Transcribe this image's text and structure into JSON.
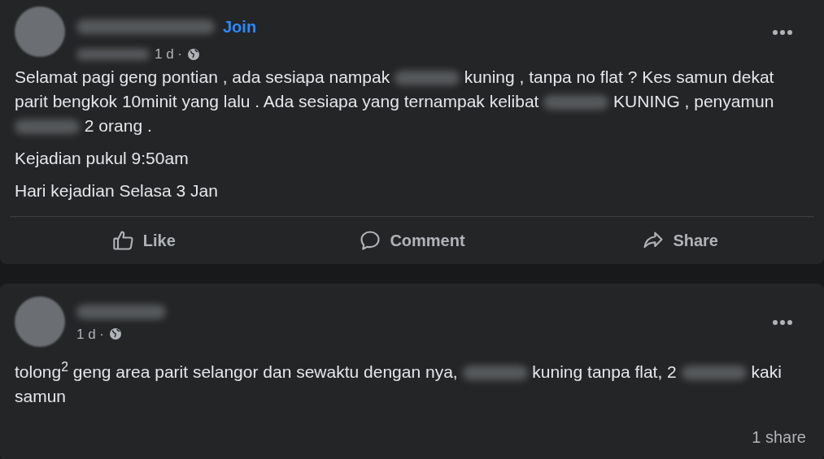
{
  "posts": [
    {
      "join_label": "Join",
      "time": "1 d ·",
      "paragraphs": [
        [
          {
            "kind": "text",
            "text": "Selamat pagi geng pontian , ada sesiapa nampak "
          },
          {
            "kind": "redacted"
          },
          {
            "kind": "text",
            "text": " kuning , tanpa no flat ? Kes samun dekat parit bengkok 10minit yang lalu . Ada sesiapa yang ternampak kelibat "
          },
          {
            "kind": "redacted"
          },
          {
            "kind": "text",
            "text": " KUNING , penyamun "
          },
          {
            "kind": "redacted"
          },
          {
            "kind": "text",
            "text": " 2 orang ."
          }
        ],
        [
          {
            "kind": "text",
            "text": "Kejadian pukul 9:50am"
          }
        ],
        [
          {
            "kind": "text",
            "text": "Hari kejadian Selasa 3 Jan"
          }
        ]
      ],
      "actions": [
        {
          "kind": "like",
          "label": "Like"
        },
        {
          "kind": "comment",
          "label": "Comment"
        },
        {
          "kind": "share",
          "label": "Share"
        }
      ]
    },
    {
      "time": "1 d ·",
      "paragraphs": [
        [
          {
            "kind": "text",
            "text": "tolong$^{2}$ geng area parit selangor dan sewaktu dengan nya, "
          },
          {
            "kind": "redacted"
          },
          {
            "kind": "text",
            "text": " kuning tanpa flat, 2 "
          },
          {
            "kind": "redacted"
          },
          {
            "kind": "text",
            "text": " kaki samun"
          }
        ]
      ],
      "share_count": "1 share"
    }
  ]
}
